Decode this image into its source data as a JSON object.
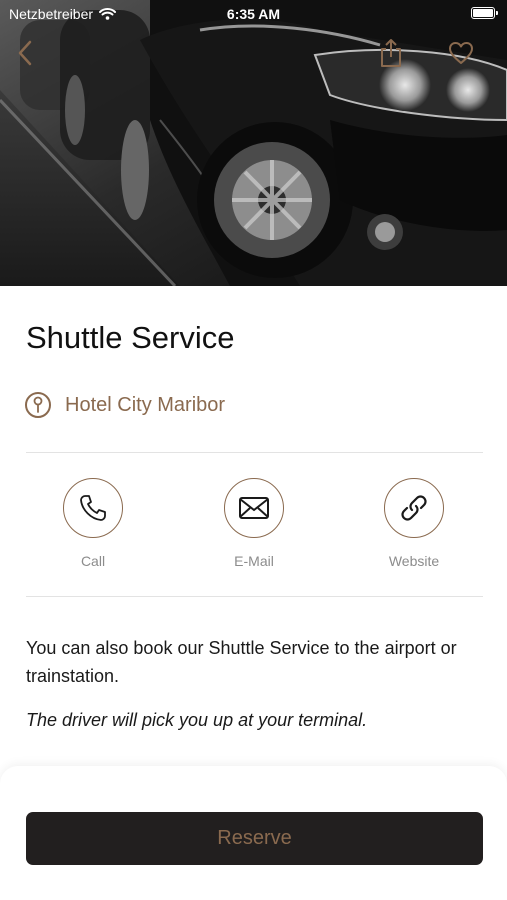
{
  "status_bar": {
    "carrier": "Netzbetreiber",
    "time": "6:35 AM",
    "icons": [
      "wifi-icon",
      "battery-icon"
    ]
  },
  "hero": {
    "image": "black-car-photo",
    "buttons": [
      "back-icon",
      "share-icon",
      "heart-icon"
    ]
  },
  "detail": {
    "title": "Shuttle Service",
    "location": "Hotel City Maribor",
    "location_icon": "location-pin-icon"
  },
  "actions": [
    {
      "label": "Call",
      "icon": "phone-icon"
    },
    {
      "label": "E-Mail",
      "icon": "mail-icon"
    },
    {
      "label": "Website",
      "icon": "link-icon"
    }
  ],
  "description": "You can also book our Shuttle Service to the airport or trainstation.",
  "note": "The driver will pick you up at your terminal.",
  "reserve_label": "Reserve",
  "colors": {
    "accent": "#8a6a4f",
    "button_bg": "#221f1f",
    "label_gray": "#8c8c8c"
  }
}
